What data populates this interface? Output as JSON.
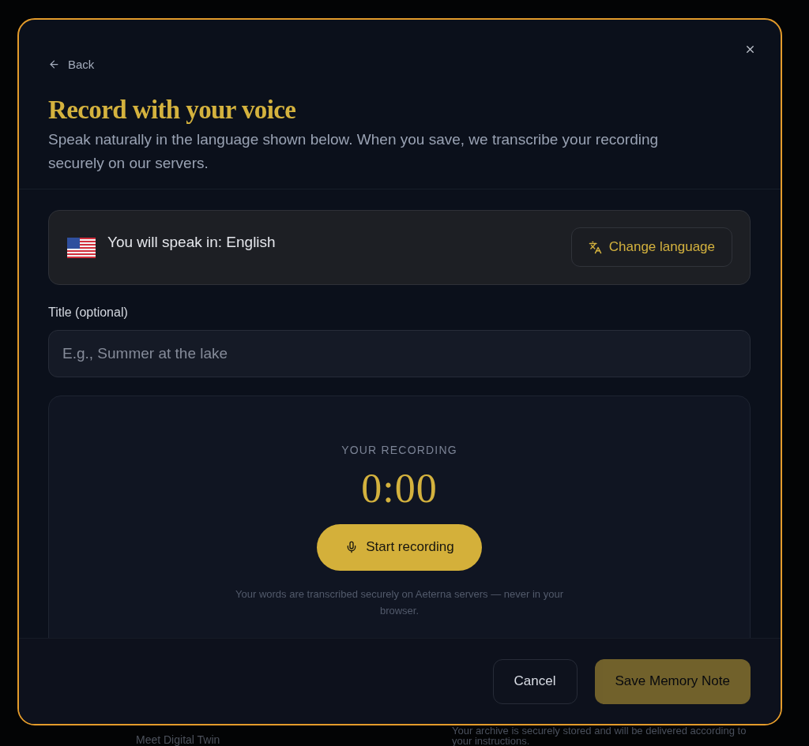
{
  "background_page": {
    "card_title": "Meet Digital Twin",
    "archive_note": "Your archive is securely stored and will be delivered according to your instructions."
  },
  "dialog": {
    "back_link": "Back",
    "title": "Record with your voice",
    "subtitle": "Speak naturally in the language shown below. When you save, we transcribe your recording securely on our servers.",
    "language": {
      "prompt": "You will speak in: English",
      "button": "Change language"
    },
    "title_field": {
      "label": "Title (optional)",
      "placeholder": "E.g., Summer at the lake"
    },
    "recorder": {
      "heading": "YOUR RECORDING",
      "timer": "0:00",
      "button": "Start recording",
      "note": "Your words are transcribed securely on Aeterna servers — never in your browser."
    },
    "footer": {
      "buttons": [
        {
          "label": "Cancel",
          "kind": "secondary",
          "disabled": false
        },
        {
          "label": "Save Memory Note",
          "kind": "primary",
          "disabled": true
        }
      ]
    }
  }
}
